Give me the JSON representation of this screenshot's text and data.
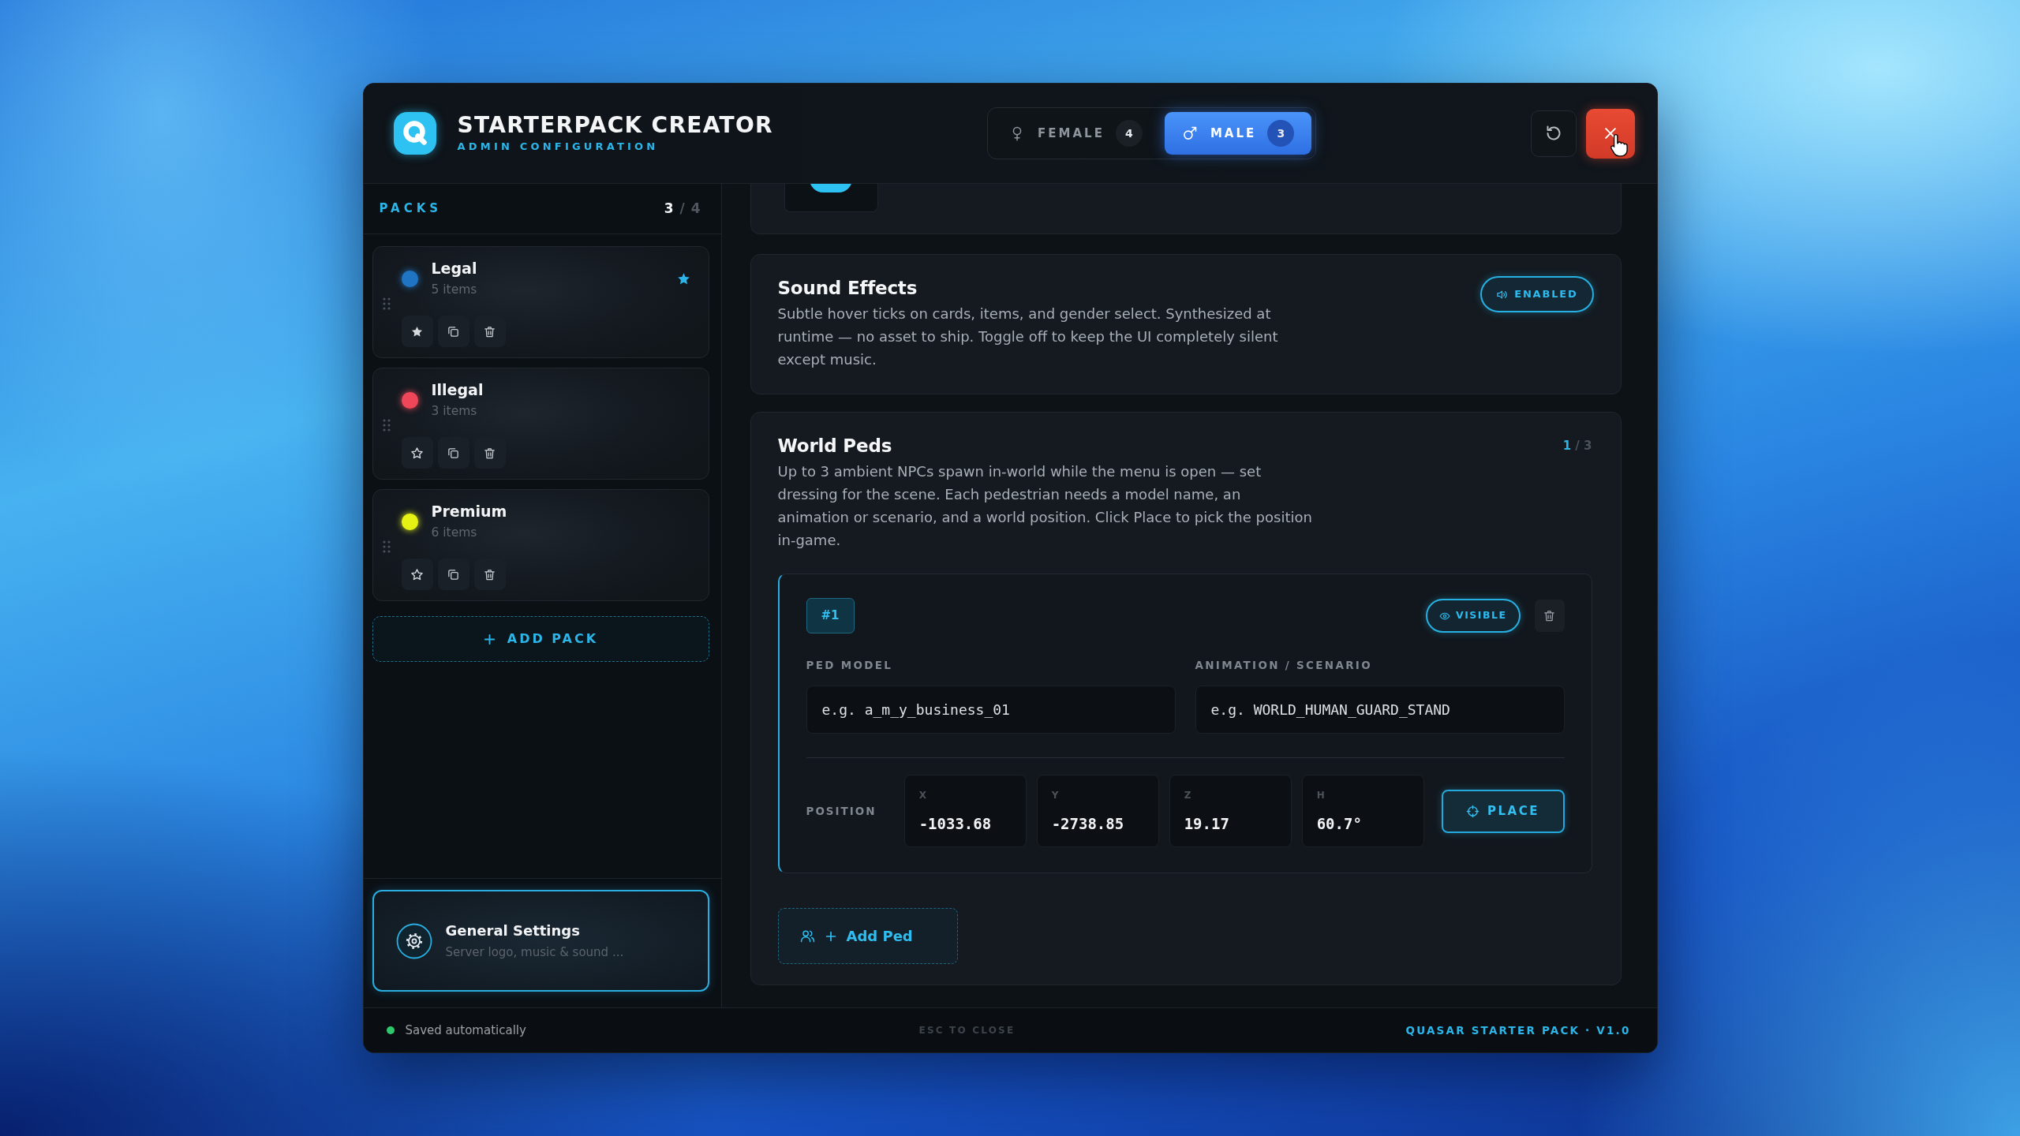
{
  "header": {
    "title": "STARTERPACK CREATOR",
    "subtitle": "ADMIN CONFIGURATION"
  },
  "gender_tabs": [
    {
      "kind": "female",
      "label": "FEMALE",
      "count": "4",
      "selected": false
    },
    {
      "kind": "male",
      "label": "MALE",
      "count": "3",
      "selected": true
    }
  ],
  "sidebar": {
    "title": "PACKS",
    "count": "**3** / 4",
    "packs": [
      {
        "name": "Legal",
        "items": "5 items",
        "color": "#1f74c4",
        "favorite": true
      },
      {
        "name": "Illegal",
        "items": "3 items",
        "color": "#ef4659",
        "favorite": false
      },
      {
        "name": "Premium",
        "items": "6 items",
        "color": "#e6f214",
        "favorite": false
      }
    ],
    "add_button": "ADD PACK",
    "settings": {
      "title": "General Settings",
      "subtitle": "Server logo, music & sound ..."
    }
  },
  "sound_effects": {
    "title": "Sound Effects",
    "description": "Subtle hover ticks on cards, items, and gender select. Synthesized at runtime — no asset to ship. Toggle off to keep the UI completely silent except music.",
    "toggle": {
      "label": "ENABLED",
      "on": true
    }
  },
  "world_peds": {
    "title": "World Peds",
    "count": "**1** / 3",
    "description": "Up to 3 ambient NPCs spawn in-world while the menu is open — set dressing for the scene. Each pedestrian needs a model name, an animation or scenario, and a world position. Click Place to pick the position in-game.",
    "peds": [
      {
        "number": "#1",
        "visibility": {
          "label": "VISIBLE",
          "on": true
        },
        "model_label": "PED MODEL",
        "model_placeholder": "e.g. a_m_y_business_01",
        "animation_label": "ANIMATION / SCENARIO",
        "animation_placeholder": "e.g. WORLD_HUMAN_GUARD_STAND",
        "position_label": "POSITION",
        "coordinates": [
          {
            "axis": "X",
            "value": "-1033.68"
          },
          {
            "axis": "Y",
            "value": "-2738.85"
          },
          {
            "axis": "Z",
            "value": "19.17"
          },
          {
            "axis": "H",
            "value": "60.7°"
          }
        ],
        "place_button": "PLACE"
      }
    ],
    "add_button": "Add Ped"
  },
  "footer": {
    "status": "Saved automatically",
    "hint": "ESC TO CLOSE",
    "brand": "QUASAR STARTER PACK · V1.0"
  }
}
